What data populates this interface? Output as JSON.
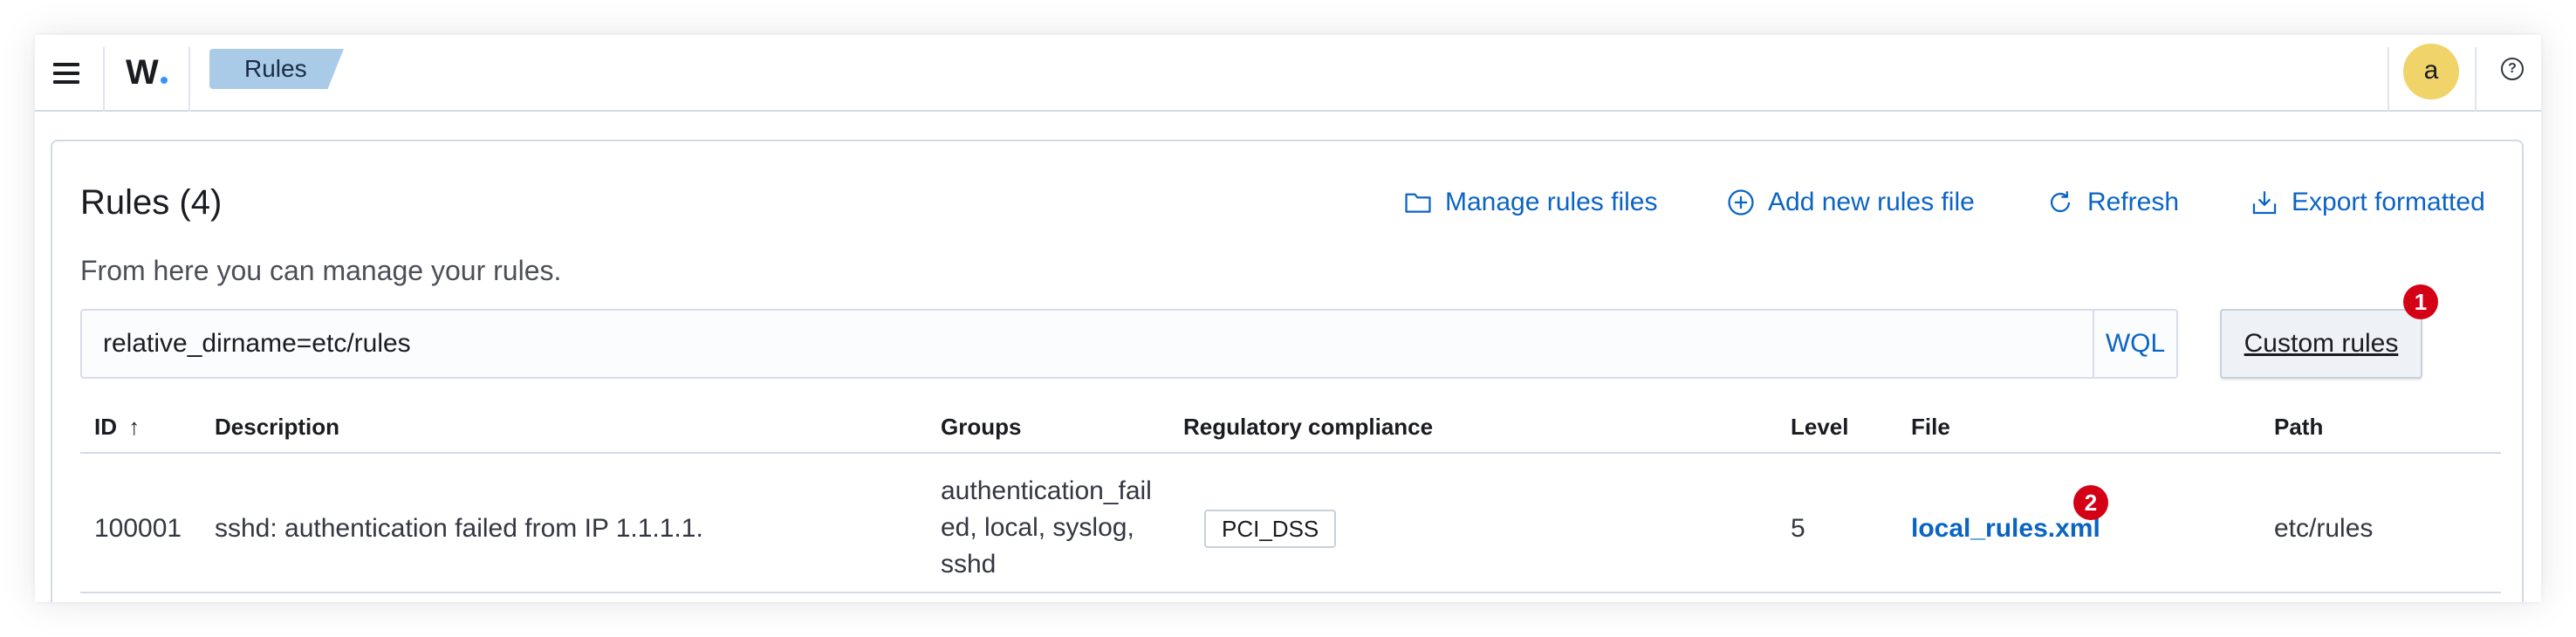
{
  "header": {
    "brand": "W",
    "breadcrumb": "Rules",
    "avatar_initial": "a",
    "help_symbol": "?"
  },
  "page": {
    "title": "Rules (4)",
    "subtitle": "From here you can manage your rules.",
    "actions": [
      {
        "label": "Manage rules files",
        "icon": "folder-icon"
      },
      {
        "label": "Add new rules file",
        "icon": "plus-circle-icon"
      },
      {
        "label": "Refresh",
        "icon": "refresh-icon"
      },
      {
        "label": "Export formatted",
        "icon": "download-icon"
      }
    ]
  },
  "search": {
    "value": "relative_dirname=etc/rules",
    "wql_label": "WQL"
  },
  "filter_button": {
    "label": "Custom rules",
    "badge": "1"
  },
  "table": {
    "columns": [
      "ID",
      "Description",
      "Groups",
      "Regulatory compliance",
      "Level",
      "File",
      "Path"
    ],
    "sort_indicator": "↑",
    "rows": [
      {
        "id": "100001",
        "description": "sshd: authentication failed from IP 1.1.1.1.",
        "groups_lines": [
          "authentication_fail",
          "ed, local, syslog,",
          "sshd"
        ],
        "compliance": "PCI_DSS",
        "level": "5",
        "file": "local_rules.xml",
        "file_badge": "2",
        "path": "etc/rules"
      }
    ]
  },
  "colors": {
    "link": "#0b64c4",
    "breadcrumb_bg": "#a9cbe8",
    "avatar_bg": "#f0d46a",
    "badge": "#d40016"
  }
}
